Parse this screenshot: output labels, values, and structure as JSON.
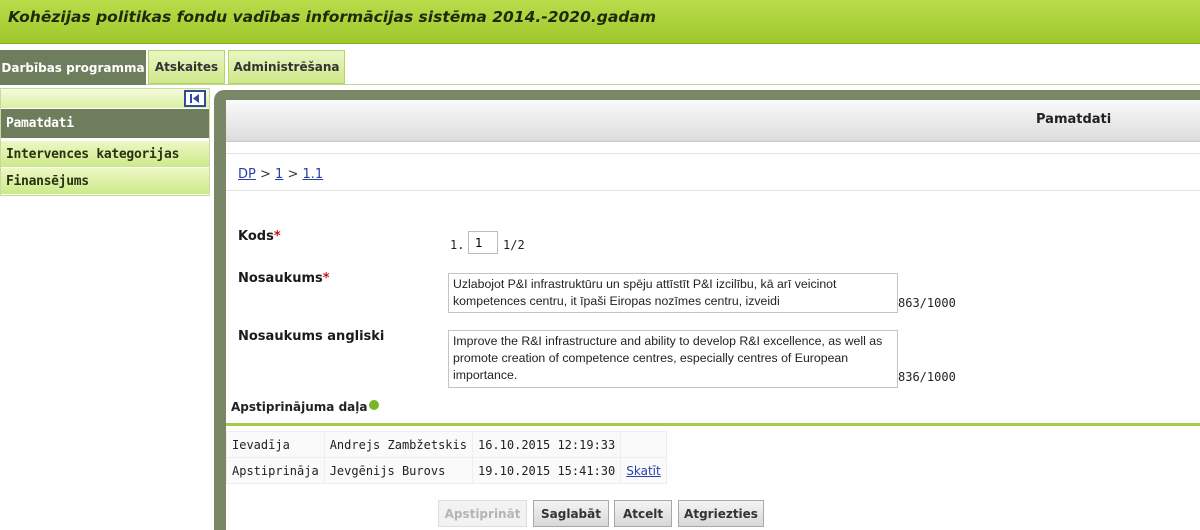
{
  "app": {
    "title": "Kohēzijas politikas fondu vadības informācijas sistēma 2014.-2020.gadam"
  },
  "tabs": [
    {
      "label": "Darbības programma",
      "active": true
    },
    {
      "label": "Atskaites",
      "active": false
    },
    {
      "label": "Administrēšana",
      "active": false
    }
  ],
  "sidebar": {
    "collapse_icon": "collapse-left-icon",
    "items": [
      {
        "label": "Pamatdati",
        "active": true
      },
      {
        "label": "Intervences kategorijas",
        "active": false
      },
      {
        "label": "Finansējums",
        "active": false
      }
    ]
  },
  "panel": {
    "title": "Pamatdati",
    "breadcrumb": {
      "dp": "DP",
      "sep1": " > ",
      "l1": "1",
      "sep2": " > ",
      "l2": "1.1"
    }
  },
  "form": {
    "kods": {
      "label": "Kods",
      "prefix": "1.",
      "value": "1",
      "suffix": "1/2"
    },
    "nosaukums": {
      "label": "Nosaukums",
      "value": "Uzlabojot P&I infrastruktūru un spēju attīstīt P&I izcilību, kā arī veicinot kompetences centru, it īpaši Eiropas nozīmes centru, izveidi",
      "counter": "863/1000"
    },
    "nosaukums_en": {
      "label": "Nosaukums angliski",
      "value": "Improve the R&I infrastructure and ability to develop R&I excellence, as well as promote creation of competence centres, especially centres of European importance.",
      "counter": "836/1000"
    },
    "required_mark": "*"
  },
  "approval": {
    "title": "Apstiprinājuma daļa",
    "rows": [
      {
        "role": "Ievadīja",
        "person": "Andrejs Zambžetskis",
        "datetime": "16.10.2015 12:19:33",
        "link": ""
      },
      {
        "role": "Apstiprināja",
        "person": "Jevgēnijs Burovs",
        "datetime": "19.10.2015 15:41:30",
        "link": "Skatīt"
      }
    ]
  },
  "buttons": {
    "approve": "Apstiprināt",
    "save": "Saglabāt",
    "cancel": "Atcelt",
    "back": "Atgriezties"
  },
  "colors": {
    "banner": "#a8d03a",
    "active_tab": "#6e7d5c",
    "accent_line": "#a7ca4b",
    "required": "#cc1111",
    "link": "#2a3ea8"
  }
}
